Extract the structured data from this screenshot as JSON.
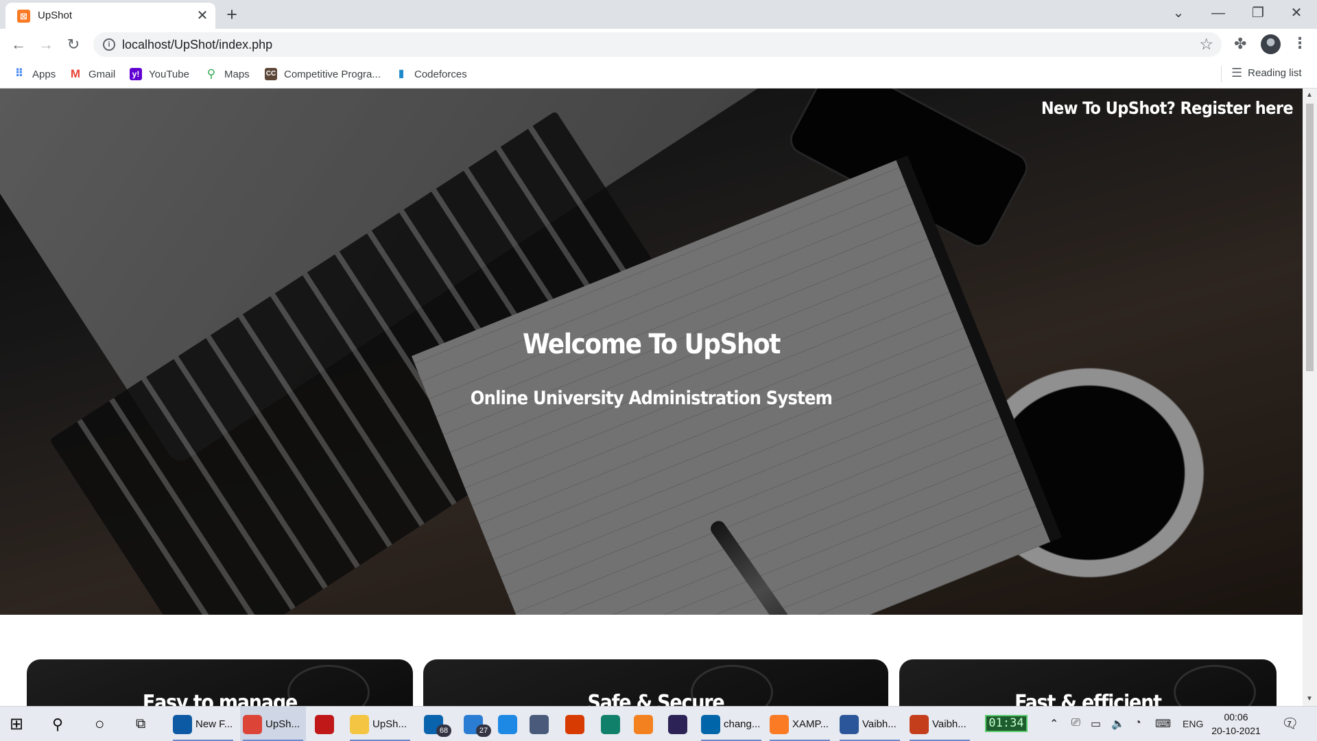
{
  "browser": {
    "tab": {
      "title": "UpShot",
      "favicon": "xampp-icon",
      "close": "✕"
    },
    "new_tab": "+",
    "window_controls": [
      "⌄",
      "—",
      "❐",
      "✕"
    ],
    "url": "localhost/UpShot/index.php",
    "bookmarks": [
      {
        "label": "Apps",
        "icon": "apps-grid-icon",
        "color": "#4285f4"
      },
      {
        "label": "Gmail",
        "icon": "gmail-icon",
        "color": "#ea4335"
      },
      {
        "label": "YouTube",
        "icon": "yahoo-icon",
        "color": "#6001d2"
      },
      {
        "label": "Maps",
        "icon": "maps-icon",
        "color": "#34a853"
      },
      {
        "label": "Competitive Progra...",
        "icon": "cc-icon",
        "color": "#5b4638"
      },
      {
        "label": "Codeforces",
        "icon": "codeforces-icon",
        "color": "#1f8acb"
      }
    ],
    "reading_list": "Reading list"
  },
  "page": {
    "register_link": "New To UpShot? Register here",
    "hero_title": "Welcome To UpShot",
    "hero_subtitle": "Online University Administration System",
    "features": [
      "Easy to manage",
      "Safe & Secure",
      "Fast & efficient"
    ]
  },
  "taskbar": {
    "items": [
      {
        "label": "New F...",
        "icon": "edge-icon",
        "color": "#0c59a4"
      },
      {
        "label": "UpSh...",
        "icon": "chrome-icon",
        "color": "#db4437",
        "active": true
      },
      {
        "label": "",
        "icon": "mcafee-icon",
        "color": "#c01818"
      },
      {
        "label": "UpSh...",
        "icon": "folder-icon",
        "color": "#f4c542"
      },
      {
        "label": "",
        "icon": "mail-icon",
        "color": "#0a64ad",
        "badge": "68"
      },
      {
        "label": "",
        "icon": "calendar-icon",
        "color": "#2b7cd3",
        "badge": "27"
      },
      {
        "label": "",
        "icon": "l-app-icon",
        "color": "#1e88e5"
      },
      {
        "label": "",
        "icon": "cube-icon",
        "color": "#4a5a7a"
      },
      {
        "label": "",
        "icon": "office-icon",
        "color": "#d83b01"
      },
      {
        "label": "",
        "icon": "arrow-app-icon",
        "color": "#11806a"
      },
      {
        "label": "",
        "icon": "sublime-icon",
        "color": "#f48120"
      },
      {
        "label": "",
        "icon": "eclipse-icon",
        "color": "#2c2255"
      },
      {
        "label": "chang...",
        "icon": "vscode-icon",
        "color": "#0065a9"
      },
      {
        "label": "XAMP...",
        "icon": "xampp-icon",
        "color": "#fb7a24"
      },
      {
        "label": "Vaibh...",
        "icon": "word-icon",
        "color": "#2b579a"
      },
      {
        "label": "Vaibh...",
        "icon": "powerpoint-icon",
        "color": "#c43e1c"
      }
    ],
    "timer": "01:34",
    "language": "ENG",
    "time": "00:06",
    "date": "20-10-2021",
    "notifications": "7"
  }
}
